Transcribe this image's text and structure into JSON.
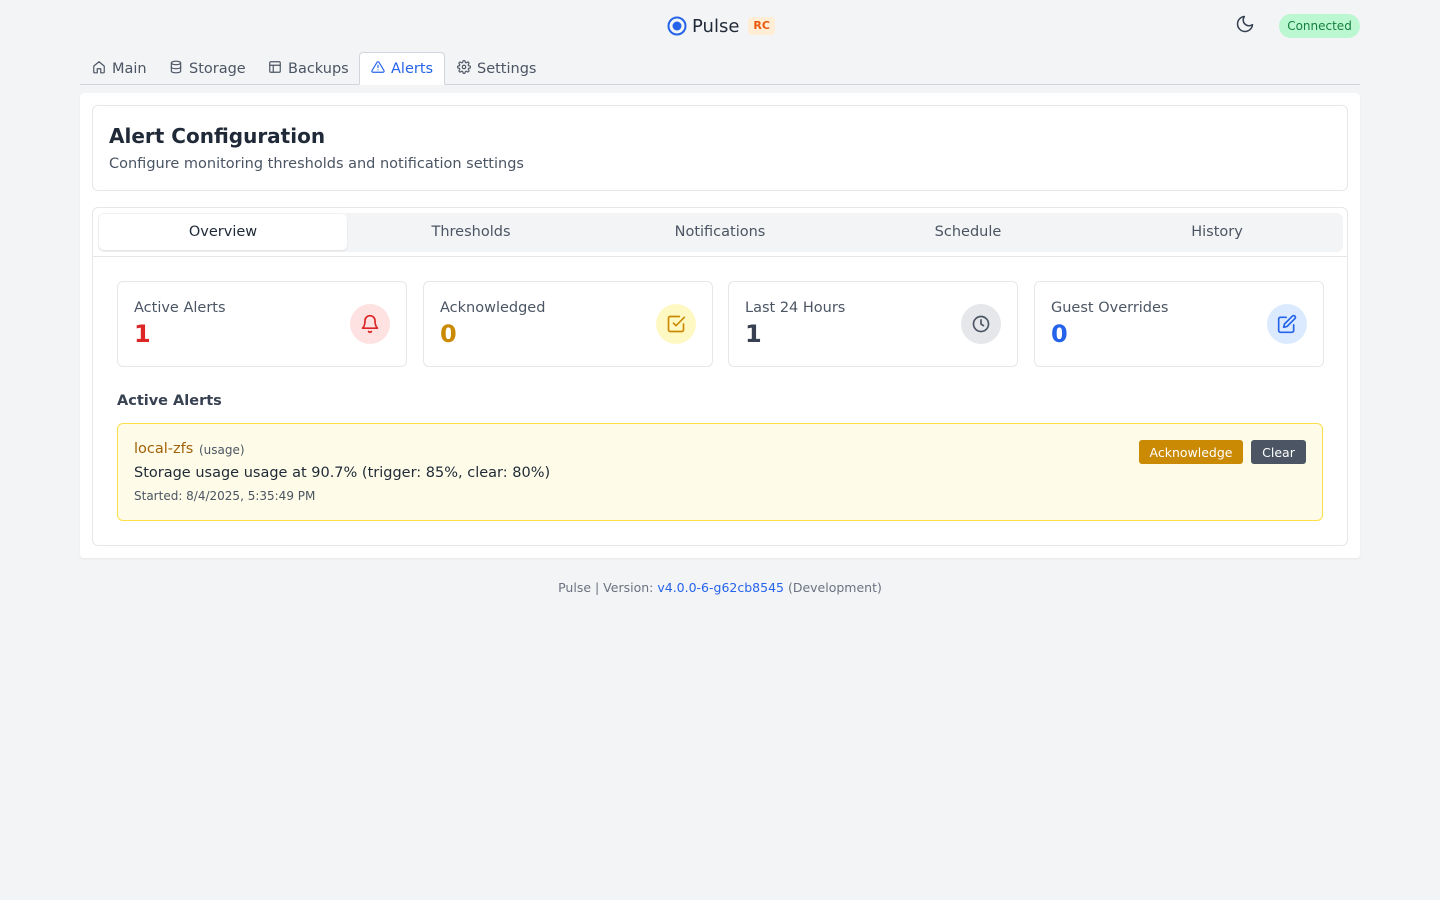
{
  "app": {
    "name": "Pulse",
    "badge": "RC",
    "connection_status": "Connected",
    "theme_icon": "moon-icon",
    "colors": {
      "accent": "#2563eb",
      "badge": "#ea580c",
      "connected": "#15803d"
    }
  },
  "nav": {
    "tabs": [
      {
        "label": "Main",
        "icon": "home-icon"
      },
      {
        "label": "Storage",
        "icon": "database-icon"
      },
      {
        "label": "Backups",
        "icon": "layout-icon"
      },
      {
        "label": "Alerts",
        "icon": "alert-triangle-icon",
        "active": true
      },
      {
        "label": "Settings",
        "icon": "gear-icon"
      }
    ]
  },
  "page": {
    "title": "Alert Configuration",
    "subtitle": "Configure monitoring thresholds and notification settings"
  },
  "subtabs": [
    {
      "label": "Overview",
      "active": true
    },
    {
      "label": "Thresholds"
    },
    {
      "label": "Notifications"
    },
    {
      "label": "Schedule"
    },
    {
      "label": "History"
    }
  ],
  "stats": [
    {
      "label": "Active Alerts",
      "value": "1",
      "icon": "bell-icon",
      "color": "#dc2626"
    },
    {
      "label": "Acknowledged",
      "value": "0",
      "icon": "check-square-icon",
      "color": "#ca8a04"
    },
    {
      "label": "Last 24 Hours",
      "value": "1",
      "icon": "clock-icon",
      "color": "#374151"
    },
    {
      "label": "Guest Overrides",
      "value": "0",
      "icon": "edit-icon",
      "color": "#2563eb"
    }
  ],
  "active_alerts": {
    "heading": "Active Alerts",
    "items": [
      {
        "resource": "local-zfs",
        "type": "(usage)",
        "message": "Storage usage usage at 90.7% (trigger: 85%, clear: 80%)",
        "started": "Started: 8/4/2025, 5:35:49 PM",
        "acknowledge_label": "Acknowledge",
        "clear_label": "Clear"
      }
    ]
  },
  "footer": {
    "prefix": "Pulse | Version: ",
    "version": "v4.0.0-6-g62cb8545",
    "suffix": " (Development)"
  }
}
